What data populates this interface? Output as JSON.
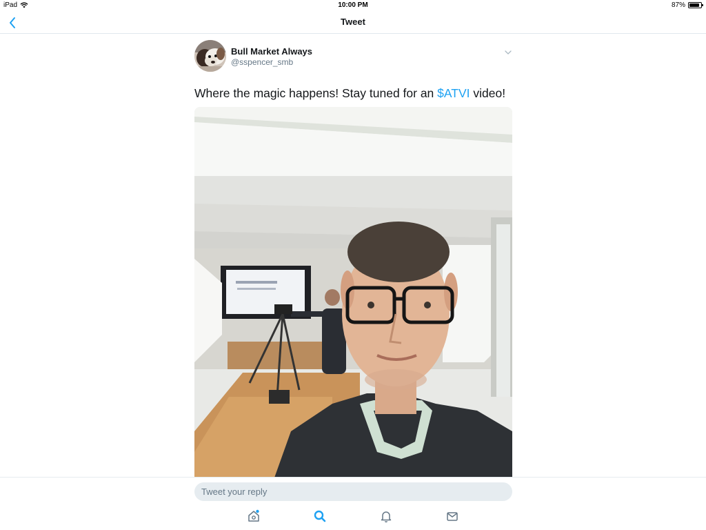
{
  "status_bar": {
    "device": "iPad",
    "time": "10:00 PM",
    "battery": "87%",
    "battery_level": 0.87
  },
  "nav": {
    "title": "Tweet",
    "back_icon": "chevron-left-icon"
  },
  "tweet": {
    "author_name": "Bull Market Always",
    "author_handle": "@sspencer_smb",
    "text_before": "Where the magic happens! Stay tuned for an ",
    "cashtag": "$ATVI",
    "text_after": " video!"
  },
  "reply": {
    "placeholder": "Tweet your reply"
  },
  "tab_bar": {
    "items": [
      "home-icon",
      "search-icon",
      "notifications-icon",
      "messages-icon"
    ],
    "active": "search-icon"
  },
  "colors": {
    "accent": "#1da1f2",
    "secondary_text": "#657786",
    "input_bg": "#e6ecf0"
  }
}
